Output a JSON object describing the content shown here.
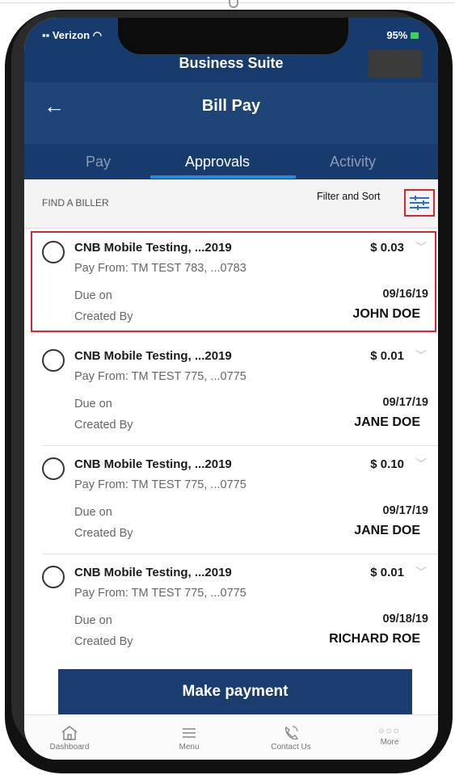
{
  "status": {
    "carrier": "Verizon",
    "battery": "95%"
  },
  "header": {
    "app_title": "Business Suite",
    "page_title": "Bill Pay"
  },
  "tabs": [
    {
      "label": "Pay"
    },
    {
      "label": "Approvals"
    },
    {
      "label": "Activity"
    }
  ],
  "filter": {
    "find_label": "FIND A BILLER",
    "filter_label": "Filter and Sort"
  },
  "labels": {
    "due_on": "Due on",
    "created_by": "Created By"
  },
  "approvals": [
    {
      "name": "CNB Mobile Testing, ...2019",
      "pay_from": "Pay From: TM TEST 783, ...0783",
      "amount": "$ 0.03",
      "due_date": "09/16/19",
      "created_by": "JOHN DOE"
    },
    {
      "name": "CNB Mobile Testing, ...2019",
      "pay_from": "Pay From: TM TEST 775, ...0775",
      "amount": "$ 0.01",
      "due_date": "09/17/19",
      "created_by": "JANE DOE"
    },
    {
      "name": "CNB Mobile Testing, ...2019",
      "pay_from": "Pay From: TM TEST 775, ...0775",
      "amount": "$ 0.10",
      "due_date": "09/17/19",
      "created_by": "JANE DOE"
    },
    {
      "name": "CNB Mobile Testing, ...2019",
      "pay_from": "Pay From: TM TEST 775, ...0775",
      "amount": "$ 0.01",
      "due_date": "09/18/19",
      "created_by": "RICHARD ROE"
    }
  ],
  "actions": {
    "make_payment": "Make payment"
  },
  "bottom_nav": [
    {
      "label": "Dashboard",
      "icon": "home-icon"
    },
    {
      "label": "Menu",
      "icon": "menu-icon"
    },
    {
      "label": "Contact Us",
      "icon": "phone-icon"
    },
    {
      "label": "More",
      "icon": "more-dots-icon"
    }
  ],
  "colors": {
    "header": "#183b6e",
    "accent": "#2a88d8",
    "highlight": "#d9262c",
    "button": "#1b3c6e"
  }
}
